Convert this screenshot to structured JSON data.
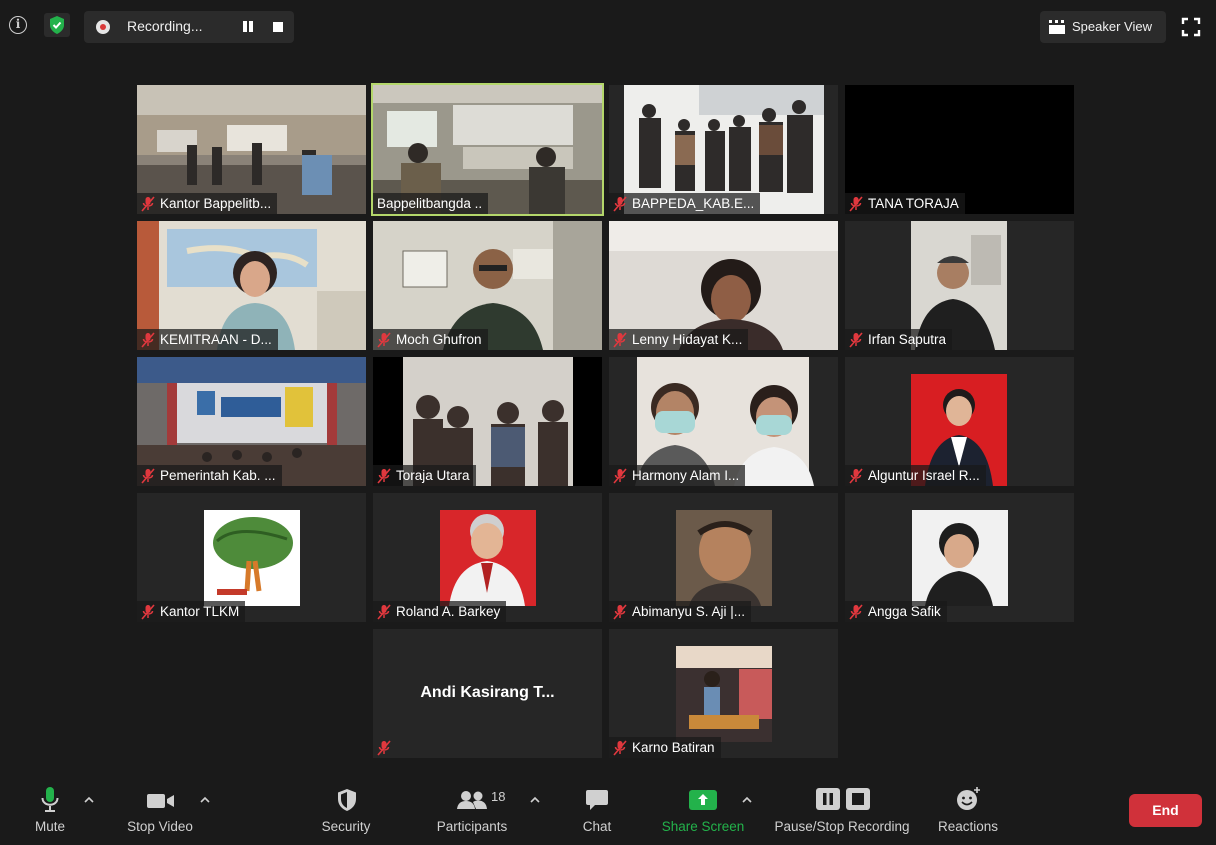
{
  "topbar": {
    "recording_label": "Recording...",
    "speaker_view_label": "Speaker View"
  },
  "participants": [
    {
      "name": "Kantor Bappelitb...",
      "muted": true,
      "active": false
    },
    {
      "name": "Bappelitbangda ..",
      "muted": false,
      "active": true
    },
    {
      "name": "BAPPEDA_KAB.E...",
      "muted": true,
      "active": false
    },
    {
      "name": "TANA TORAJA",
      "muted": true,
      "active": false
    },
    {
      "name": "KEMITRAAN - D...",
      "muted": true,
      "active": false
    },
    {
      "name": "Moch Ghufron",
      "muted": true,
      "active": false
    },
    {
      "name": "Lenny Hidayat K...",
      "muted": true,
      "active": false
    },
    {
      "name": "Irfan Saputra",
      "muted": true,
      "active": false
    },
    {
      "name": "Pemerintah Kab. ...",
      "muted": true,
      "active": false
    },
    {
      "name": "Toraja Utara",
      "muted": true,
      "active": false
    },
    {
      "name": "Harmony Alam I...",
      "muted": true,
      "active": false
    },
    {
      "name": "Alguntur Israel R...",
      "muted": true,
      "active": false
    },
    {
      "name": "Kantor TLKM",
      "muted": true,
      "active": false
    },
    {
      "name": "Roland A. Barkey",
      "muted": true,
      "active": false
    },
    {
      "name": "Abimanyu S. Aji |...",
      "muted": true,
      "active": false
    },
    {
      "name": "Angga Safik",
      "muted": true,
      "active": false
    },
    {
      "name": "Andi Kasirang T...",
      "muted": true,
      "active": false,
      "no_video": true
    },
    {
      "name": "Karno Batiran",
      "muted": true,
      "active": false
    }
  ],
  "toolbar": {
    "mute_label": "Mute",
    "stop_video_label": "Stop Video",
    "security_label": "Security",
    "participants_label": "Participants",
    "participants_count": "18",
    "chat_label": "Chat",
    "share_screen_label": "Share Screen",
    "pause_stop_recording_label": "Pause/Stop Recording",
    "reactions_label": "Reactions",
    "end_label": "End"
  },
  "colors": {
    "background": "#1a1a1a",
    "tile": "#262626",
    "active_outline": "#b4d76b",
    "muted_red": "#e0383e",
    "share_green": "#23b24b",
    "end_red": "#d0313a",
    "shield_green": "#23b24b"
  }
}
